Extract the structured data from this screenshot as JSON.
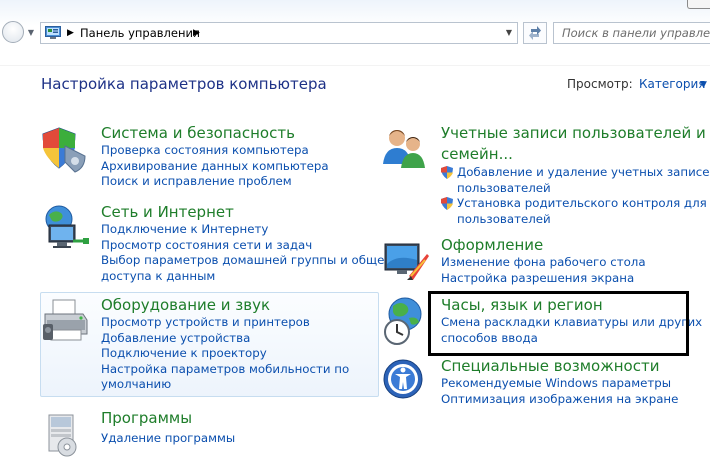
{
  "address_bar": {
    "path": "Панель управления",
    "search_placeholder": "Поиск в панели управления"
  },
  "header": {
    "title": "Настройка параметров компьютера",
    "view_label": "Просмотр:",
    "view_value": "Категория"
  },
  "left_categories": [
    {
      "title": "Система и безопасность",
      "links": [
        "Проверка состояния компьютера",
        "Архивирование данных компьютера",
        "Поиск и исправление проблем"
      ]
    },
    {
      "title": "Сеть и Интернет",
      "links": [
        "Подключение к Интернету",
        "Просмотр состояния сети и задач",
        "Выбор параметров домашней группы и общего",
        "доступа к данным"
      ]
    },
    {
      "title": "Оборудование и звук",
      "links": [
        "Просмотр устройств и принтеров",
        "Добавление устройства",
        "Подключение к проектору",
        "Настройка параметров мобильности по",
        "умолчанию"
      ]
    },
    {
      "title": "Программы",
      "links": [
        "Удаление программы"
      ]
    }
  ],
  "right_categories": [
    {
      "title_line1": "Учетные записи пользователей и",
      "title_line2": "семейн...",
      "links": [
        "Добавление и удаление учетных записей",
        "пользователей",
        "Установка родительского контроля для всех",
        "пользователей"
      ]
    },
    {
      "title": "Оформление",
      "links": [
        "Изменение фона рабочего стола",
        "Настройка разрешения экрана"
      ]
    },
    {
      "title": "Часы, язык и регион",
      "links": [
        "Смена раскладки клавиатуры или других",
        "способов ввода"
      ]
    },
    {
      "title": "Специальные возможности",
      "links": [
        "Рекомендуемые Windows параметры",
        "Оптимизация изображения на экране"
      ]
    }
  ],
  "icons": {
    "system_security": "shield-icon",
    "network": "network-icon",
    "hardware": "printer-icon",
    "programs": "programs-icon",
    "user_accounts": "users-icon",
    "appearance": "appearance-icon",
    "clock_region": "globe-clock-icon",
    "ease_of_access": "ease-of-access-icon"
  },
  "colors": {
    "category_title": "#1e7d2a",
    "link": "#0b4fae",
    "page_title": "#1e3287",
    "highlight_frame": "#000000"
  }
}
